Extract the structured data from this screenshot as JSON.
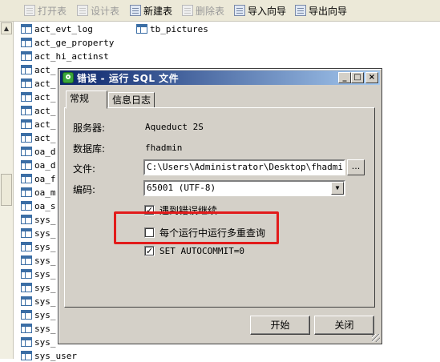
{
  "toolbar": {
    "items": [
      {
        "label": "打开表",
        "enabled": false
      },
      {
        "label": "设计表",
        "enabled": false
      },
      {
        "label": "新建表",
        "enabled": true
      },
      {
        "label": "删除表",
        "enabled": false
      },
      {
        "label": "导入向导",
        "enabled": true
      },
      {
        "label": "导出向导",
        "enabled": true
      }
    ]
  },
  "tables": {
    "column1": [
      "act_evt_log",
      "act_ge_property",
      "act_hi_actinst",
      "act_",
      "act_",
      "act_",
      "act_",
      "act_",
      "act_",
      "oa_d",
      "oa_d",
      "oa_f",
      "oa_m",
      "oa_s",
      "sys_",
      "sys_",
      "sys_",
      "sys_",
      "sys_",
      "sys_",
      "sys_",
      "sys_",
      "sys_",
      "sys_",
      "sys_user"
    ],
    "column2": [
      "tb_pictures"
    ]
  },
  "dialog": {
    "title": "错误 - 运行 SQL 文件",
    "tabs": [
      "常规",
      "信息日志"
    ],
    "server_label": "服务器:",
    "server_value": "Aqueduct 2S",
    "database_label": "数据库:",
    "database_value": "fhadmin",
    "file_label": "文件:",
    "file_value": "C:\\Users\\Administrator\\Desktop\\fhadmin.sql",
    "browse_label": "...",
    "encoding_label": "编码:",
    "encoding_value": "65001 (UTF-8)",
    "options": [
      {
        "label": "遇到错误继续",
        "checked": true
      },
      {
        "label": "每个运行中运行多重查询",
        "checked": false
      },
      {
        "label": "SET AUTOCOMMIT=0",
        "checked": true
      }
    ],
    "start_label": "开始",
    "close_label": "关闭"
  },
  "colors": {
    "highlight": "#e21b1b",
    "titlebar_start": "#0a246a",
    "titlebar_end": "#a6caf0"
  }
}
